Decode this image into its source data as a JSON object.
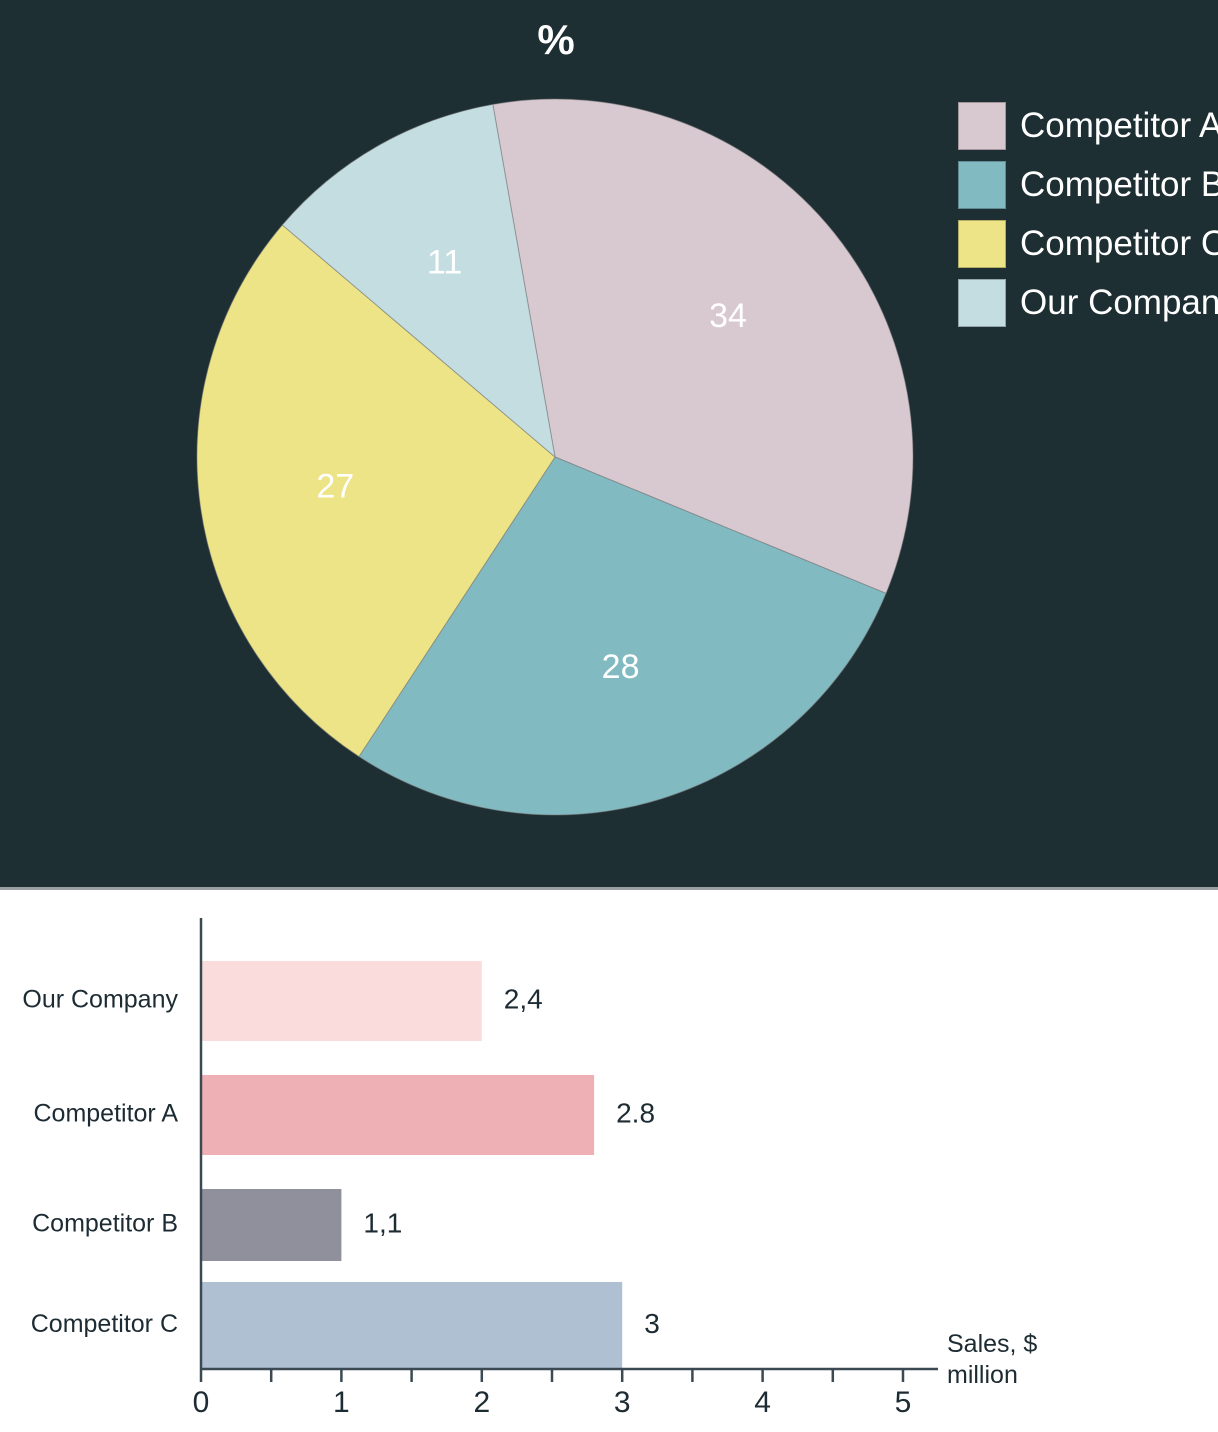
{
  "theme": {
    "pie_panel_bg": "#1e2f33",
    "bar_panel_bg": "#ffffff",
    "pie_text": "#ffffff",
    "bar_text": "#1d2b33",
    "axis_color": "#3b4a52",
    "panel_divider": "#9aa0a2"
  },
  "pie_chart": {
    "title": "%",
    "legend": [
      {
        "label": "Competitor A",
        "color": "#d8c8d0"
      },
      {
        "label": "Competitor B",
        "color": "#82bac1"
      },
      {
        "label": "Competitor C",
        "color": "#ece486"
      },
      {
        "label": "Our Company",
        "color": "#c3dde1"
      }
    ]
  },
  "bar_chart": {
    "axis_title_line1": "Sales, $",
    "axis_title_line2": "million",
    "tick_labels": [
      "0",
      "1",
      "2",
      "3",
      "4",
      "5"
    ],
    "rows": [
      {
        "category": "Our Company",
        "value_label": "2,4",
        "value": 2.0,
        "color": "#fadcdc"
      },
      {
        "category": "Competitor A",
        "value_label": "2.8",
        "value": 2.8,
        "color": "#efb0b5"
      },
      {
        "category": "Competitor B",
        "value_label": "1,1",
        "value": 1.0,
        "color": "#8f909c"
      },
      {
        "category": "Competitor C",
        "value_label": "3",
        "value": 3.0,
        "color": "#aec0d2"
      }
    ]
  },
  "chart_data": [
    {
      "type": "pie",
      "title": "%",
      "categories": [
        "Competitor A",
        "Competitor B",
        "Competitor C",
        "Our Company"
      ],
      "values": [
        34,
        28,
        27,
        11
      ],
      "labels": [
        "34",
        "28",
        "27",
        "11"
      ],
      "colors": [
        "#d8c8d0",
        "#82bac1",
        "#ece486",
        "#c3dde1"
      ],
      "legend_position": "right",
      "unit": "%",
      "start_angle_deg": -10,
      "direction": "clockwise"
    },
    {
      "type": "bar",
      "orientation": "horizontal",
      "title": "",
      "categories": [
        "Our Company",
        "Competitor A",
        "Competitor B",
        "Competitor C"
      ],
      "values": [
        2.0,
        2.8,
        1.0,
        3.0
      ],
      "data_labels": [
        "2,4",
        "2.8",
        "1,1",
        "3"
      ],
      "colors": [
        "#fadcdc",
        "#efb0b5",
        "#8f909c",
        "#aec0d2"
      ],
      "xlabel": "Sales, $ million",
      "ylabel": "",
      "xlim": [
        0,
        5
      ],
      "xticks": [
        0,
        1,
        2,
        3,
        4,
        5
      ],
      "minor_tick_step": 0.5,
      "grid": false,
      "legend_position": "none"
    }
  ]
}
